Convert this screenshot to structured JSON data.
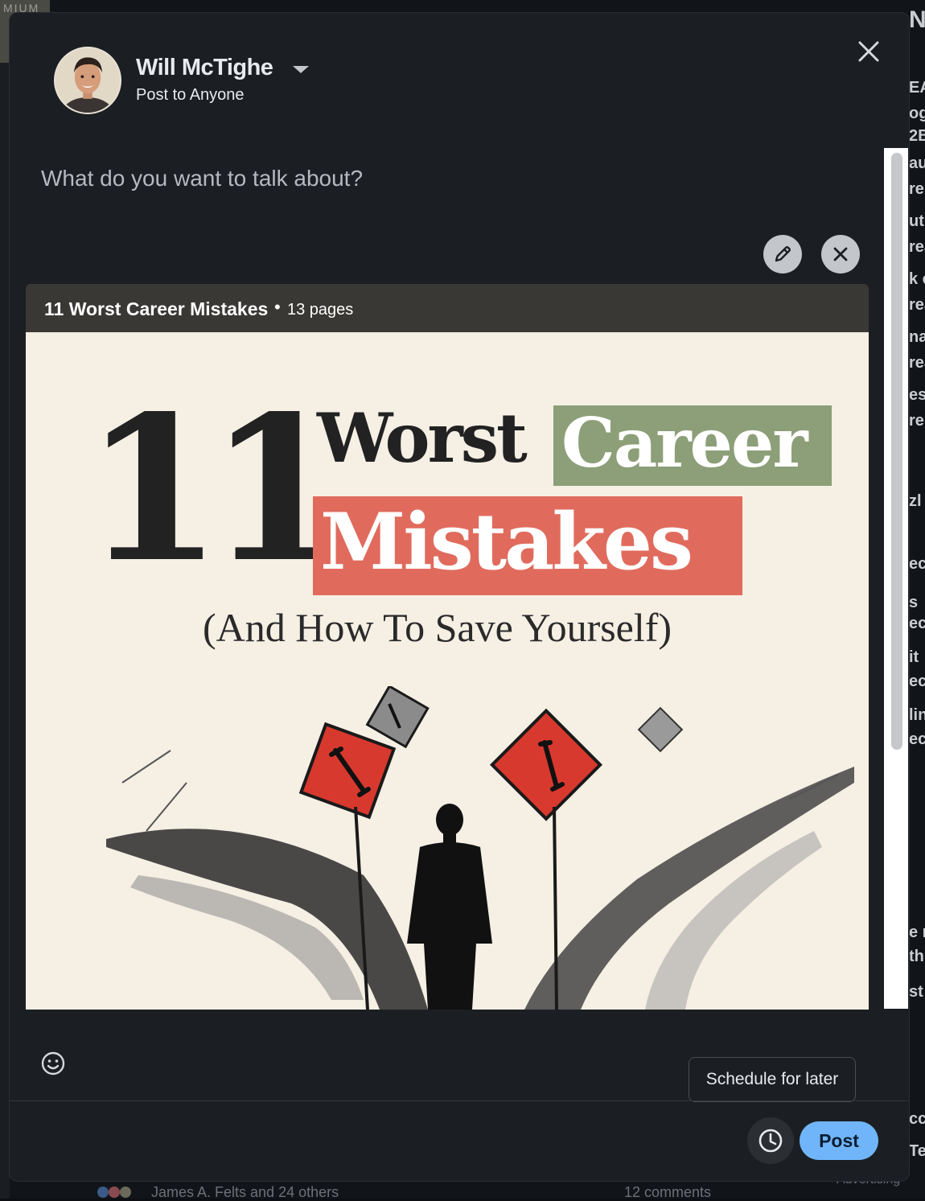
{
  "background": {
    "corner_text": "MIUM",
    "right_fragments": [
      "Ne",
      "EAI",
      "og",
      "2B",
      "au",
      "re",
      "ut",
      "rea",
      "k c",
      "rea",
      "nal",
      "rea",
      "es",
      "re",
      "zl",
      "ect",
      "s",
      "ect",
      "it",
      "ect",
      "lin",
      "ect",
      "e r",
      "th",
      "st",
      "cce",
      "Te"
    ],
    "feed_reactions_text": "James A. Felts and 24 others",
    "feed_comments_text": "12 comments",
    "advertising_text": "Advertising"
  },
  "composer": {
    "author_name": "Will McTighe",
    "audience_label": "Post to Anyone",
    "prompt_placeholder": "What do you want to talk about?",
    "document": {
      "title": "11 Worst Career Mistakes",
      "separator": "•",
      "pages_label": "13 pages",
      "slide": {
        "number": "11",
        "word_worst": "Worst",
        "word_career": "Career",
        "word_mistakes": "Mistakes",
        "subtitle": "(And How To Save Yourself)"
      }
    },
    "schedule_tooltip": "Schedule for later",
    "post_label": "Post"
  },
  "icons": {
    "close": "close-icon",
    "caret": "chevron-down-icon",
    "edit": "pencil-icon",
    "remove": "remove-icon",
    "emoji": "smiley-icon",
    "schedule": "clock-icon"
  },
  "colors": {
    "modal_bg": "#1b1f23",
    "post_button": "#70b5f9",
    "career_highlight": "#8c9f78",
    "mistakes_highlight": "#e06b5d",
    "slide_bg": "#f5efe4"
  }
}
